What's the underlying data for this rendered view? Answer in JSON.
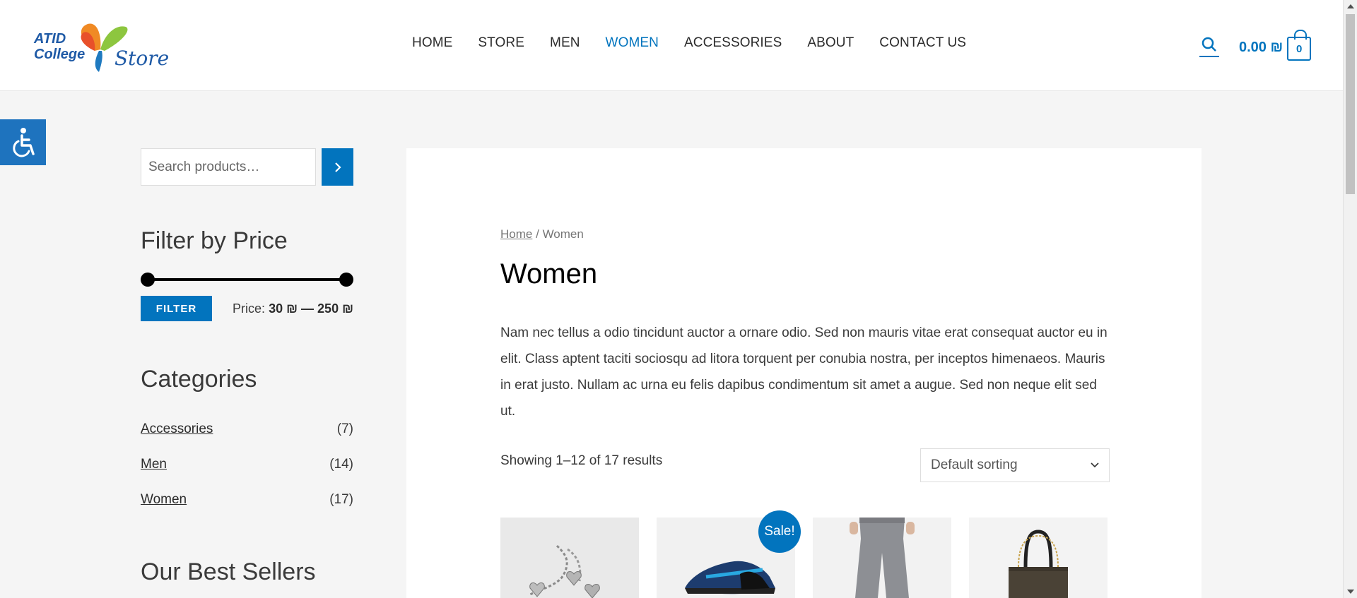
{
  "header": {
    "logo": {
      "line1": "ATID",
      "line2": "College",
      "line3": "Store"
    },
    "nav": [
      "HOME",
      "STORE",
      "MEN",
      "WOMEN",
      "ACCESSORIES",
      "ABOUT",
      "CONTACT US"
    ],
    "active_nav": "WOMEN",
    "search_icon": "search-icon",
    "cart": {
      "total": "0.00 ₪",
      "count": "0",
      "icon": "shopping-bag-icon"
    }
  },
  "accessibility": {
    "icon": "wheelchair-icon"
  },
  "sidebar": {
    "search": {
      "placeholder": "Search products…",
      "button_icon": "chevron-right-icon"
    },
    "filter_by_price": {
      "title": "Filter by Price",
      "button_label": "FILTER",
      "price_prefix": "Price:",
      "min": "30 ₪",
      "separator": "—",
      "max": "250 ₪"
    },
    "categories": {
      "title": "Categories",
      "items": [
        {
          "label": "Accessories",
          "count": "(7)"
        },
        {
          "label": "Men",
          "count": "(14)"
        },
        {
          "label": "Women",
          "count": "(17)"
        }
      ]
    },
    "best_sellers": {
      "title": "Our Best Sellers"
    }
  },
  "main": {
    "breadcrumb": {
      "home": "Home",
      "separator": "/",
      "current": "Women"
    },
    "title": "Women",
    "description": "Nam nec tellus a odio tincidunt auctor a ornare odio. Sed non mauris vitae erat consequat auctor eu in elit. Class aptent taciti sociosqu ad litora torquent per conubia nostra, per inceptos himenaeos. Mauris in erat justo. Nullam ac urna eu felis dapibus condimentum sit amet a augue. Sed non neque elit sed ut.",
    "result_count": "Showing 1–12 of 17 results",
    "sort": {
      "selected": "Default sorting"
    },
    "sale_badge": "Sale!",
    "products": [
      {
        "image": "silver-heart-bracelet"
      },
      {
        "image": "blue-sneakers"
      },
      {
        "image": "grey-jeans"
      },
      {
        "image": "brown-handbag"
      }
    ]
  },
  "colors": {
    "accent": "#0274be",
    "text": "#3a3a3a",
    "background": "#f5f5f5"
  }
}
